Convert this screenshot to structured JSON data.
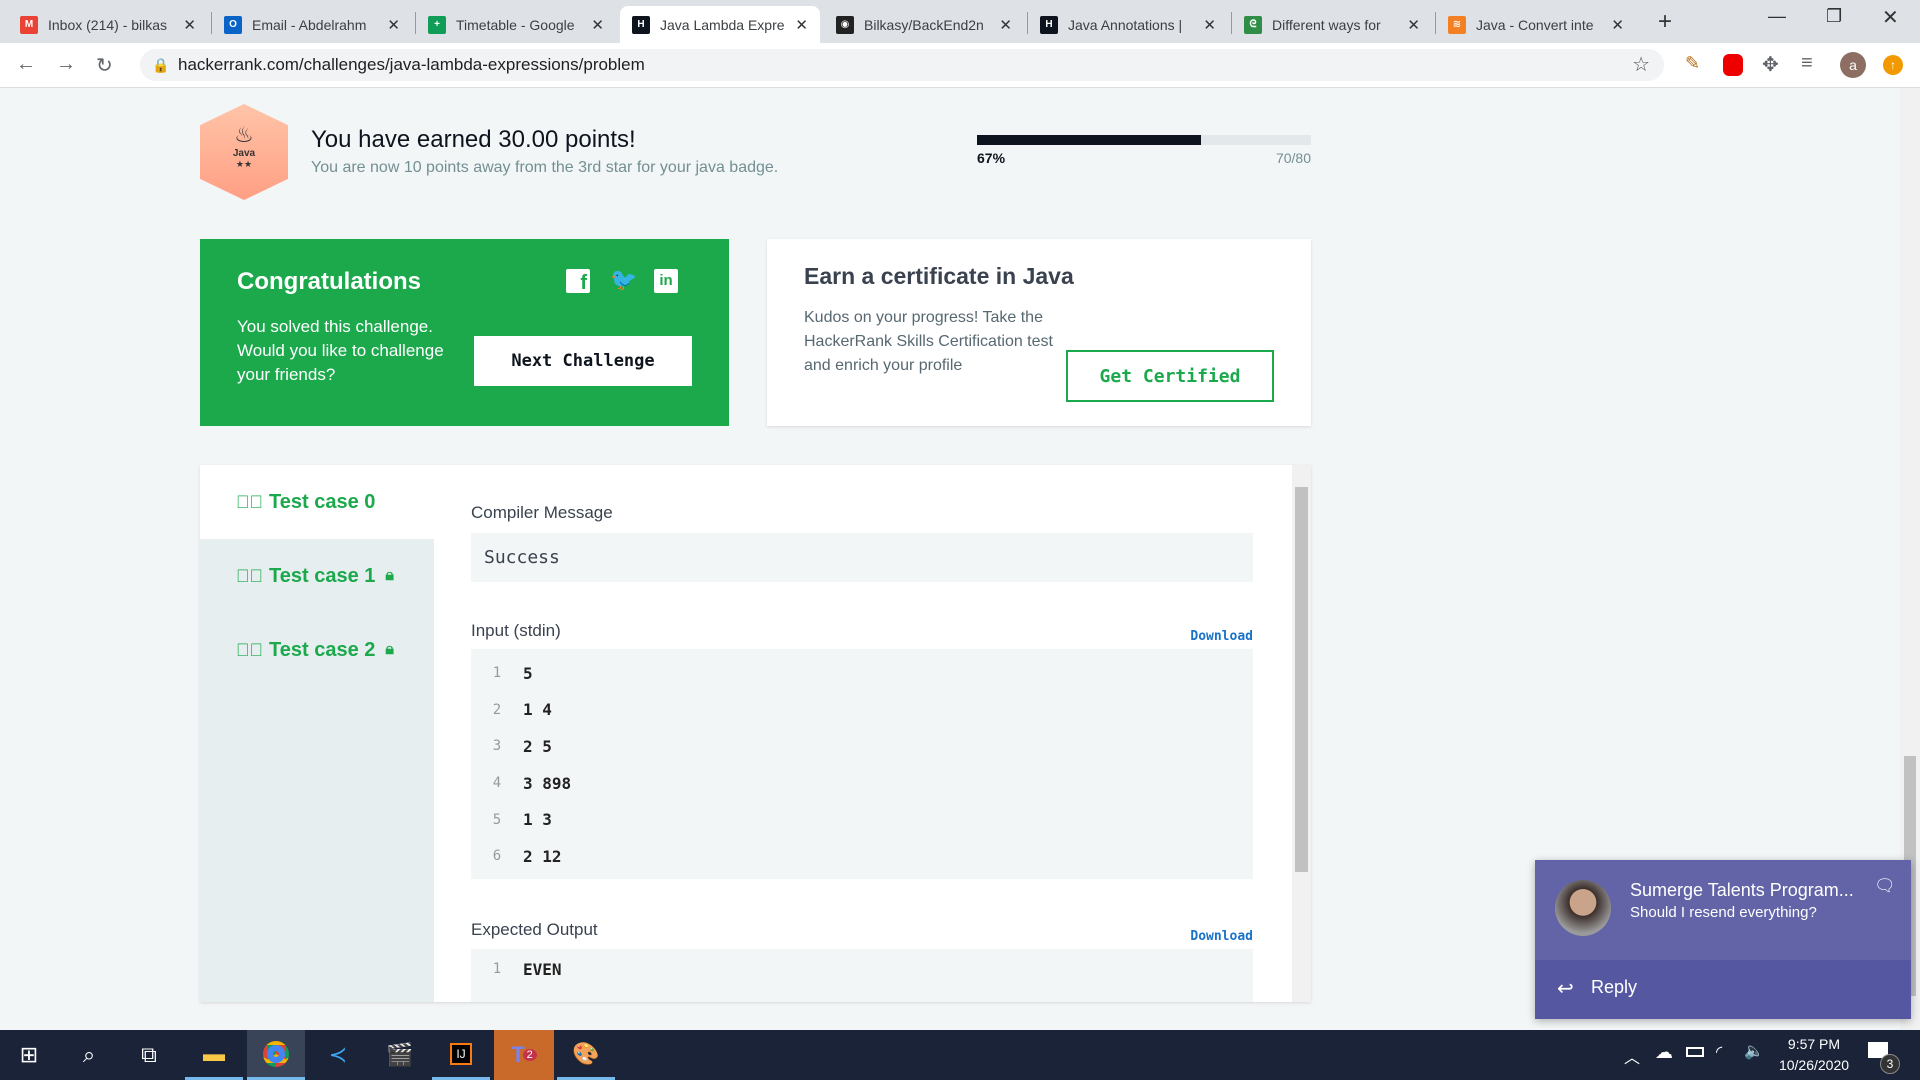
{
  "browser": {
    "tabs": [
      {
        "title": "Inbox (214) - bilkas",
        "icon": "gmail-icon",
        "color": "#ea4335",
        "glyph": "M"
      },
      {
        "title": "Email - Abdelrahm",
        "icon": "outlook-icon",
        "color": "#0a64c8",
        "glyph": "O"
      },
      {
        "title": "Timetable - Google",
        "icon": "sheets-icon",
        "color": "#0f9d58",
        "glyph": "+"
      },
      {
        "title": "Java Lambda Expre",
        "icon": "hackerrank-icon",
        "color": "#0e141e",
        "glyph": "H"
      },
      {
        "title": "Bilkasy/BackEnd2n",
        "icon": "github-icon",
        "color": "#222",
        "glyph": "◉"
      },
      {
        "title": "Java Annotations |",
        "icon": "hackerrank-icon",
        "color": "#0e141e",
        "glyph": "H"
      },
      {
        "title": "Different ways for",
        "icon": "geeksforgeeks-icon",
        "color": "#2f8d46",
        "glyph": "ᘓ"
      },
      {
        "title": "Java - Convert inte",
        "icon": "stackoverflow-icon",
        "color": "#f48024",
        "glyph": "≋"
      }
    ],
    "active_tab": 3,
    "url": "hackerrank.com/challenges/java-lambda-expressions/problem",
    "profile_letter": "a"
  },
  "badge": {
    "label": "Java",
    "stars": "★★"
  },
  "points": {
    "title": "You have earned 30.00 points!",
    "subtitle": "You are now 10 points away from the 3rd star for your java badge.",
    "progress_percent": 67,
    "progress_label": "67%",
    "progress_count": "70/80"
  },
  "congrats": {
    "title": "Congratulations",
    "text": "You solved this challenge. Would you like to challenge your friends?",
    "button": "Next Challenge",
    "color": "#1ba94c"
  },
  "certificate": {
    "title": "Earn a certificate in Java",
    "text": "Kudos on your progress! Take the HackerRank Skills Certification test and enrich your profile",
    "button": "Get Certified"
  },
  "tests": {
    "cases": [
      {
        "label": "Test case 0",
        "locked": false
      },
      {
        "label": "Test case 1",
        "locked": true
      },
      {
        "label": "Test case 2",
        "locked": true
      }
    ],
    "compiler_label": "Compiler Message",
    "compiler_message": "Success",
    "input_label": "Input (stdin)",
    "download": "Download",
    "input_lines": [
      {
        "n": "1",
        "v": "5"
      },
      {
        "n": "2",
        "v": "1 4"
      },
      {
        "n": "3",
        "v": "2 5"
      },
      {
        "n": "4",
        "v": "3 898"
      },
      {
        "n": "5",
        "v": "1 3"
      },
      {
        "n": "6",
        "v": "2 12"
      }
    ],
    "expected_label": "Expected Output",
    "expected_lines": [
      {
        "n": "1",
        "v": "EVEN"
      }
    ]
  },
  "notification": {
    "title": "Sumerge Talents Program...",
    "message": "Should I resend everything?",
    "reply": "Reply"
  },
  "taskbar": {
    "time": "9:57 PM",
    "date": "10/26/2020",
    "notif_count": "3",
    "teams_badge": "2"
  }
}
